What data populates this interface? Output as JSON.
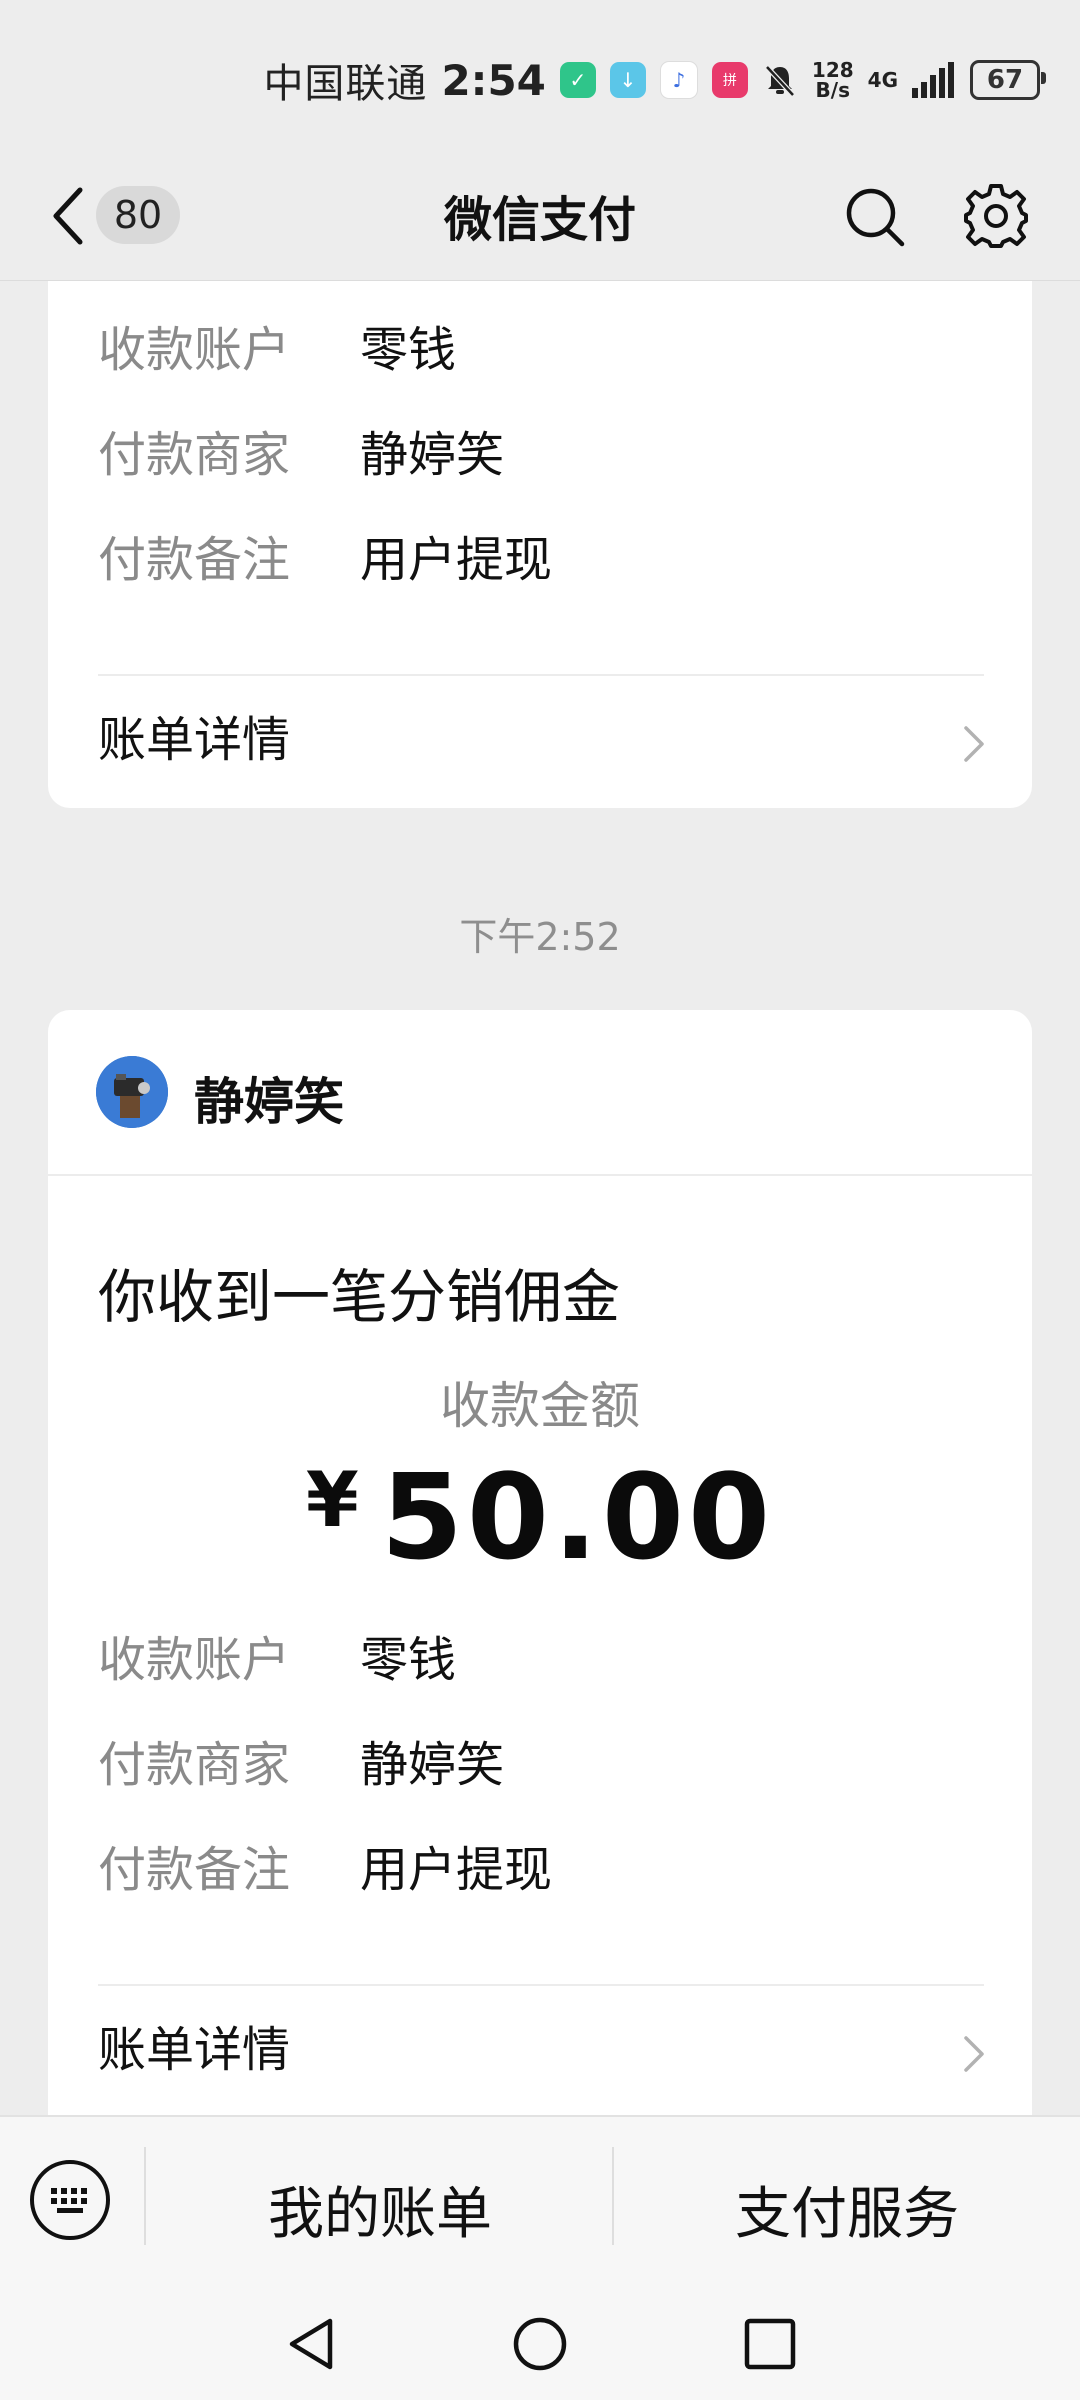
{
  "status_bar": {
    "carrier": "中国联通",
    "time": "2:54",
    "net_speed_value": "128",
    "net_speed_unit": "B/s",
    "network": "4G",
    "battery": "67"
  },
  "nav": {
    "badge": "80",
    "title": "微信支付"
  },
  "card_top": {
    "rows": [
      {
        "label": "收款账户",
        "value": "零钱"
      },
      {
        "label": "付款商家",
        "value": "静婷笑"
      },
      {
        "label": "付款备注",
        "value": "用户提现"
      }
    ],
    "detail": "账单详情"
  },
  "timestamp": "下午2:52",
  "card_main": {
    "sender": "静婷笑",
    "title": "你收到一笔分销佣金",
    "amount_label": "收款金额",
    "currency": "¥",
    "amount": "50.00",
    "rows": [
      {
        "label": "收款账户",
        "value": "零钱"
      },
      {
        "label": "付款商家",
        "value": "静婷笑"
      },
      {
        "label": "付款备注",
        "value": "用户提现"
      }
    ],
    "detail": "账单详情"
  },
  "bottom_menu": {
    "bills": "我的账单",
    "services": "支付服务"
  },
  "colors": {
    "background": "#ededed",
    "card": "#ffffff",
    "label_gray": "#8a8a8a"
  }
}
